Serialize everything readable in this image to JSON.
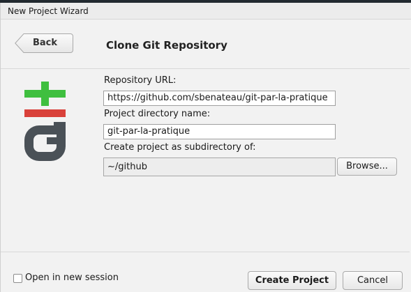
{
  "window": {
    "title": "New Project Wizard"
  },
  "header": {
    "back_label": "Back",
    "page_title": "Clone Git Repository"
  },
  "form": {
    "repo_url_label": "Repository URL:",
    "repo_url_value": "https://github.com/sbenateau/git-par-la-pratique",
    "dir_name_label": "Project directory name:",
    "dir_name_value": "git-par-la-pratique",
    "subdir_label": "Create project as subdirectory of:",
    "subdir_value": "~/github",
    "browse_label": "Browse..."
  },
  "footer": {
    "new_session_label": "Open in new session",
    "new_session_checked": false,
    "create_label": "Create Project",
    "cancel_label": "Cancel"
  },
  "logo": {
    "icon": "git-logo-icon",
    "plus_color": "#3fbf3f",
    "minus_color": "#d9413a",
    "g_color": "#4a5157"
  }
}
